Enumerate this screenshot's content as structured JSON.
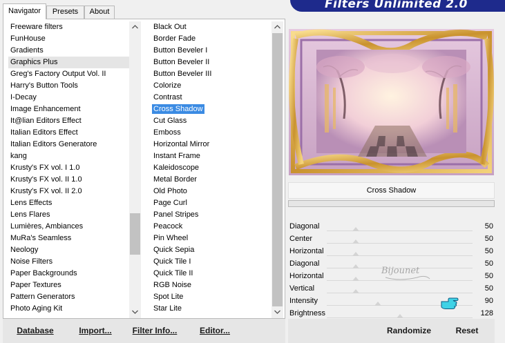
{
  "tabs": [
    {
      "label": "Navigator",
      "active": true
    },
    {
      "label": "Presets",
      "active": false
    },
    {
      "label": "About",
      "active": false
    }
  ],
  "banner": {
    "title": "Filters Unlimited 2.0"
  },
  "categories": {
    "items": [
      "Freeware filters",
      "FunHouse",
      "Gradients",
      "Graphics Plus",
      "Greg's Factory Output Vol. II",
      "Harry's Button Tools",
      "I-Decay",
      "Image Enhancement",
      "It@lian Editors Effect",
      "Italian Editors Effect",
      "Italian Editors Generatore",
      "kang",
      "Krusty's FX vol. I 1.0",
      "Krusty's FX vol. II 1.0",
      "Krusty's FX vol. II 2.0",
      "Lens Effects",
      "Lens Flares",
      "Lumières, Ambiances",
      "MuRa's Seamless",
      "Neology",
      "Noise Filters",
      "Paper Backgrounds",
      "Paper Textures",
      "Pattern Generators",
      "Photo Aging Kit"
    ],
    "highlighted": "Graphics Plus"
  },
  "filters": {
    "items": [
      "Black Out",
      "Border Fade",
      "Button Beveler I",
      "Button Beveler II",
      "Button Beveler III",
      "Colorize",
      "Contrast",
      "Cross Shadow",
      "Cut Glass",
      "Emboss",
      "Horizontal Mirror",
      "Instant Frame",
      "Kaleidoscope",
      "Metal Border",
      "Old Photo",
      "Page Curl",
      "Panel Stripes",
      "Peacock",
      "Pin Wheel",
      "Quick Sepia",
      "Quick Tile I",
      "Quick Tile II",
      "RGB Noise",
      "Spot Lite",
      "Star Lite"
    ],
    "selected": "Cross Shadow"
  },
  "filter_title": "Cross Shadow",
  "params": [
    {
      "name": "Diagonal",
      "value": "50",
      "level": 0.2
    },
    {
      "name": "Center",
      "value": "50",
      "level": 0.2
    },
    {
      "name": "Horizontal",
      "value": "50",
      "level": 0.2
    },
    {
      "name": "Diagonal",
      "value": "50",
      "level": 0.2
    },
    {
      "name": "Horizontal",
      "value": "50",
      "level": 0.2
    },
    {
      "name": "Vertical",
      "value": "50",
      "level": 0.2
    },
    {
      "name": "Intensity",
      "value": "90",
      "level": 0.35
    },
    {
      "name": "Brightness",
      "value": "128",
      "level": 0.5
    }
  ],
  "watermark_text": "Bijounet",
  "buttons": {
    "database": "Database",
    "import": "Import...",
    "filter_info": "Filter Info...",
    "editor": "Editor...",
    "randomize": "Randomize",
    "reset": "Reset"
  },
  "colors": {
    "selection": "#3b8be3",
    "banner": "#1e2a8c"
  },
  "icons": {
    "scroll_up": "chevron-up-icon",
    "scroll_down": "chevron-down-icon",
    "cursor": "pointing-hand-icon"
  }
}
